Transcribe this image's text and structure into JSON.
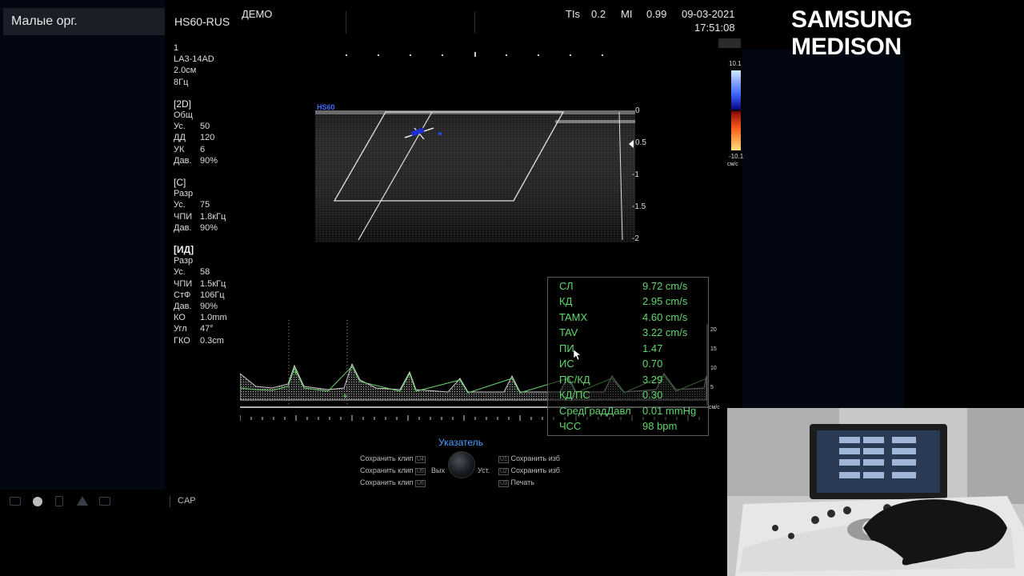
{
  "preset": "Малые орг.",
  "header": {
    "system": "HS60-RUS",
    "mode": "ДЕМО",
    "tis_label": "TIs",
    "tis_value": "0.2",
    "mi_label": "MI",
    "mi_value": "0.99",
    "date": "09-03-2021",
    "time": "17:51:08"
  },
  "params": {
    "top": [
      "1",
      "LA3-14AD",
      "2.0см",
      "8Гц"
    ],
    "b2d": {
      "title": "[2D]",
      "lines": [
        "Общ"
      ],
      "rows": [
        [
          "Ус.",
          "50"
        ],
        [
          "ДД",
          "120"
        ],
        [
          "УК",
          "6"
        ],
        [
          "Дав.",
          "90%"
        ]
      ]
    },
    "color": {
      "title": "[C]",
      "lines": [
        "Разр"
      ],
      "rows": [
        [
          "Ус.",
          "75"
        ],
        [
          "ЧПИ",
          "1.8кГц"
        ],
        [
          "Дав.",
          "90%"
        ]
      ]
    },
    "pw": {
      "title": "[ИД]",
      "lines": [
        "Разр"
      ],
      "rows": [
        [
          "Ус.",
          "58"
        ],
        [
          "ЧПИ",
          "1.5кГц"
        ],
        [
          "СтФ",
          "106Гц"
        ],
        [
          "Дав.",
          "90%"
        ],
        [
          "КО",
          "1.0mm"
        ],
        [
          "Угл",
          "47°"
        ],
        [
          "ГКО",
          "0.3cm"
        ]
      ]
    }
  },
  "image_label": "HS60",
  "depth_scale": [
    "0",
    "0.5",
    "-1",
    "-1.5",
    "-2"
  ],
  "color_bar": {
    "top": "10.1",
    "bottom": "-10.1",
    "unit": "см/с"
  },
  "doppler_scale": {
    "ticks": [
      "20",
      "15",
      "10",
      "5"
    ],
    "unit": "см/с"
  },
  "measurements": [
    {
      "label": "СЛ",
      "value": "9.72 cm/s"
    },
    {
      "label": "КД",
      "value": "2.95 cm/s"
    },
    {
      "label": "TAMX",
      "value": "4.60 cm/s"
    },
    {
      "label": "TAV",
      "value": "3.22 cm/s"
    },
    {
      "label": "ПИ",
      "value": "1.47"
    },
    {
      "label": "ИС",
      "value": "0.70"
    },
    {
      "label": "ПС/КД",
      "value": "3.29"
    },
    {
      "label": "КД/ПС",
      "value": "0.30"
    },
    {
      "label": "СредГрадДавл",
      "value": "0.01 mmHg"
    },
    {
      "label": "ЧСС",
      "value": "98 bpm"
    }
  ],
  "controls": {
    "title": "Указатель",
    "left": [
      {
        "label": "Сохранить клип",
        "key": "U4"
      },
      {
        "label": "Сохранить клип",
        "key": "U5"
      },
      {
        "label": "Сохранить клип",
        "key": "U6"
      }
    ],
    "right": [
      {
        "label": "Сохранить изб",
        "key": "U1"
      },
      {
        "label": "Сохранить изб",
        "key": "U2"
      },
      {
        "label": "Печать",
        "key": "U3"
      }
    ],
    "exit": "Вых",
    "set": "Уст."
  },
  "status": {
    "cap": "CAP"
  },
  "brand": "SAMSUNG MEDISON",
  "colors": {
    "measure_text": "#5fd66b",
    "pointer_title": "#4aa3ff",
    "panel": "#030712"
  }
}
